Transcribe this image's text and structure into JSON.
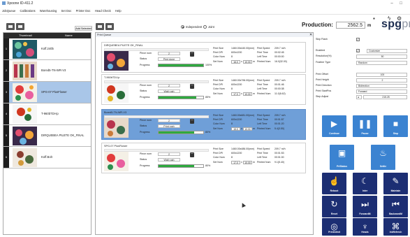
{
  "window": {
    "title": "Xpoone ID-411.2"
  },
  "menu": [
    "JobQueue",
    "Calibrations",
    "Warehousing",
    "Set Doc",
    "Printer Doc",
    "Head Check",
    "Help"
  ],
  "toolbar": {
    "add_selected": "Add Selected",
    "mode_independent": "Independent",
    "mode_joint": "Joint",
    "production_label": "Production:",
    "production_value": "2562.5",
    "production_unit": "m"
  },
  "logo": {
    "main": "spg",
    "tail": "prints"
  },
  "thumbs": {
    "headers": {
      "thumbnail": "Thumbnail",
      "name": "Name"
    },
    "rows": [
      {
        "num": "1",
        "name": "Koff.240b"
      },
      {
        "num": "2",
        "name": "Bored5-TN-WR-V3"
      },
      {
        "num": "3",
        "name": "SPG-07 PlusFlower"
      },
      {
        "num": "4",
        "name": "T-960bTDI-Ip"
      },
      {
        "num": "5",
        "name": "DIRQUEBEA PILETE OK_FINAL"
      },
      {
        "num": "6",
        "name": "Koff.Bolt"
      }
    ]
  },
  "queue": {
    "title": "Print Queue",
    "labels": {
      "piece_num": "Piece num",
      "status": "Status",
      "progress": "Progress",
      "print_size": "Print Size",
      "print_dpi": "Print DPI",
      "color_num": "Color Num",
      "set_num": "Set Num",
      "print_speed": "Print Speed",
      "print_time": "Print Time",
      "left_time": "Left Time",
      "printed_num": "Printed Num"
    },
    "jobs": [
      {
        "name": "DIRQUEBEA PILETE OK_FINAL",
        "piece": "2",
        "status": "Print done",
        "progress": 1.0,
        "pct": "100%",
        "size": "1460.00x440.00(mm)",
        "dpi": "600x1200",
        "color": "8",
        "set_a": "16.0",
        "set_b": "10.00",
        "speed": "209.7 m/h",
        "ptime": "00:02:45",
        "ltime": "00:00:00",
        "printed": "16.0(32.00)"
      },
      {
        "name": "T-960bTDI-Ip",
        "piece": "2",
        "status": "Wait rush",
        "progress": 0.85,
        "pct": "85%",
        "size": "1460.00x796.00(mm)",
        "dpi": "600x1200",
        "color": "8",
        "set_a": "17.0",
        "set_b": "10.00",
        "speed": "209.7 m/h",
        "ptime": "00:01:46",
        "ltime": "00:00:38",
        "printed": "11.0(6.62)"
      },
      {
        "name": "Bored5-TN-WR-V3",
        "piece": "2",
        "status": "Print rush",
        "progress": 0.8,
        "pct": "80%",
        "size": "1460.00x681.00(mm)",
        "dpi": "600x1200",
        "color": "8",
        "set_a": "15.0",
        "set_b": "10.00",
        "speed": "209.7 m/h",
        "ptime": "00:01:57",
        "ltime": "00:01:20",
        "printed": "5.4(3.50)"
      },
      {
        "name": "SPG-07 PlusFlower",
        "piece": "2",
        "status": "Wait rush",
        "progress": 0.8,
        "pct": "80%",
        "size": "1460.00x486.00(mm)",
        "dpi": "600x1200",
        "color": "8",
        "set_a": "17.0",
        "set_b": "10.00",
        "speed": "209.7 m/h",
        "ptime": "00:01:53",
        "ltime": "00:01:00",
        "printed": "9.1(5.40)"
      }
    ]
  },
  "settings": {
    "skip_flash": "Skip Flash",
    "enabled": "Enabled",
    "enabled_value": "Customize",
    "resolution": "Resolution(%)",
    "resolution_value": "50",
    "feather_type": "Feather Type",
    "feather_value": "Random",
    "print_offset": "Print Offset",
    "print_offset_value": "100",
    "print_height": "Print Height",
    "print_height_value": "2",
    "print_direction": "Print Direction",
    "print_direction_value": "Bidirection",
    "print_start_pos": "Print StartPos",
    "print_start_pos_value": "Forward",
    "step_adjust": "Step Adjust",
    "step_adjust_value": "215.25"
  },
  "buttons": [
    {
      "label": "Continue",
      "icon": "play-icon",
      "glyph": "▶"
    },
    {
      "label": "Pause",
      "icon": "pause-icon",
      "glyph": "❚❚"
    },
    {
      "label": "Stop",
      "icon": "stop-icon",
      "glyph": "■"
    },
    {
      "label": "PrtStatus",
      "icon": "print-status-icon",
      "glyph": "▣"
    },
    {
      "label": "Settle",
      "icon": "settle-icon",
      "glyph": "♨"
    },
    {
      "label": "Reboot",
      "icon": "reboot-icon",
      "glyph": "☝"
    },
    {
      "label": "Inter",
      "icon": "moon-icon",
      "glyph": "☾"
    },
    {
      "label": "Maintain",
      "icon": "wrench-icon",
      "glyph": "✎"
    },
    {
      "label": "Reset",
      "icon": "reset-icon",
      "glyph": "↻"
    },
    {
      "label": "ForwardM",
      "icon": "forward-icon",
      "glyph": "⏭"
    },
    {
      "label": "BackwardM",
      "icon": "backward-icon",
      "glyph": "⏮"
    },
    {
      "label": "PrintedInit",
      "icon": "printed-init-icon",
      "glyph": "◎"
    },
    {
      "label": "Heads",
      "icon": "heads-icon",
      "glyph": "♆"
    },
    {
      "label": "InkRefresh",
      "icon": "ink-refresh-icon",
      "glyph": "⌘"
    }
  ],
  "colors": {
    "accent": "#3b83d1",
    "dark_button": "#1c2e73",
    "selection": "#a9c6e8",
    "progress": "#2ea93e"
  }
}
